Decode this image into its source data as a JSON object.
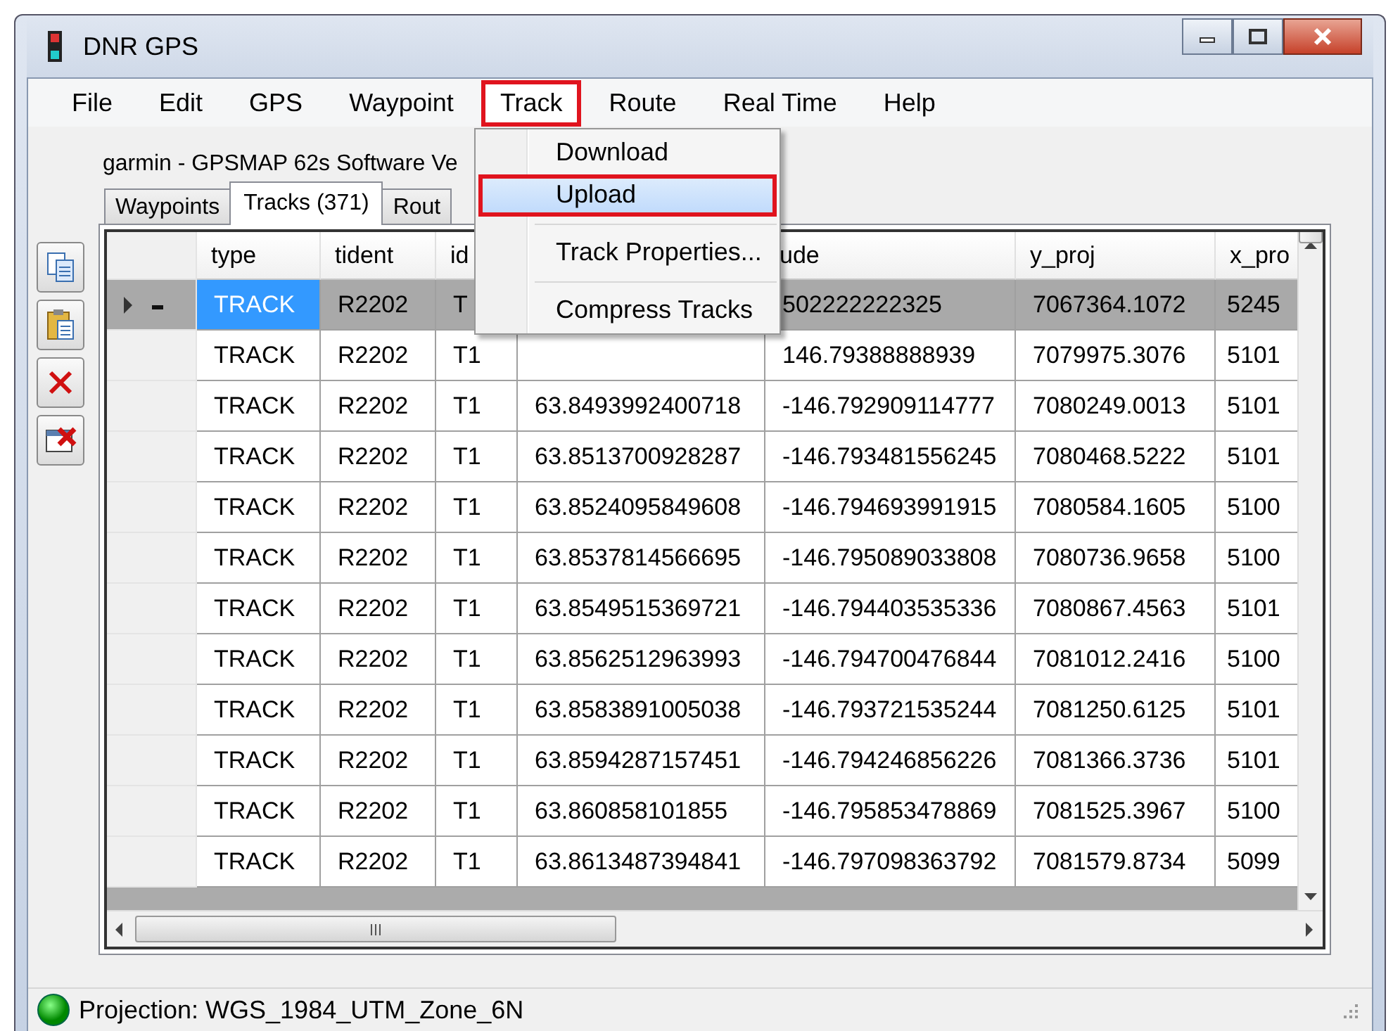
{
  "window": {
    "title": "DNR GPS"
  },
  "menu": [
    {
      "label": "File",
      "selected": false
    },
    {
      "label": "Edit",
      "selected": false
    },
    {
      "label": "GPS",
      "selected": false
    },
    {
      "label": "Waypoint",
      "selected": false
    },
    {
      "label": "Track",
      "selected": true
    },
    {
      "label": "Route",
      "selected": false
    },
    {
      "label": "Real Time",
      "selected": false
    },
    {
      "label": "Help",
      "selected": false
    }
  ],
  "dropdown": [
    {
      "kind": "item",
      "label": "Download",
      "selected": false
    },
    {
      "kind": "item",
      "label": "Upload",
      "selected": true
    },
    {
      "kind": "separator"
    },
    {
      "kind": "item",
      "label": "Track Properties...",
      "selected": false
    },
    {
      "kind": "separator"
    },
    {
      "kind": "item",
      "label": "Compress Tracks",
      "selected": false
    }
  ],
  "device": "garmin - GPSMAP 62s Software Ve",
  "tabs": [
    {
      "label": "Waypoints",
      "selected": false
    },
    {
      "label": "Tracks (371)",
      "selected": true
    },
    {
      "label": "Rout",
      "selected": false
    }
  ],
  "table": {
    "columns": [
      "type",
      "tident",
      "id",
      null,
      "ude",
      "y_proj",
      "x_pro"
    ],
    "rows": [
      {
        "selected": true,
        "current": true,
        "cells": [
          "TRACK",
          "R2202",
          "T",
          null,
          "502222222325",
          "7067364.1072",
          "5245"
        ]
      },
      {
        "selected": false,
        "current": false,
        "cells": [
          "TRACK",
          "R2202",
          "T1",
          null,
          "146.79388888939",
          "7079975.3076",
          "5101"
        ]
      },
      {
        "selected": false,
        "current": false,
        "cells": [
          "TRACK",
          "R2202",
          "T1",
          "63.8493992400718",
          "-146.792909114777",
          "7080249.0013",
          "5101"
        ]
      },
      {
        "selected": false,
        "current": false,
        "cells": [
          "TRACK",
          "R2202",
          "T1",
          "63.8513700928287",
          "-146.793481556245",
          "7080468.5222",
          "5101"
        ]
      },
      {
        "selected": false,
        "current": false,
        "cells": [
          "TRACK",
          "R2202",
          "T1",
          "63.8524095849608",
          "-146.794693991915",
          "7080584.1605",
          "5100"
        ]
      },
      {
        "selected": false,
        "current": false,
        "cells": [
          "TRACK",
          "R2202",
          "T1",
          "63.8537814566695",
          "-146.795089033808",
          "7080736.9658",
          "5100"
        ]
      },
      {
        "selected": false,
        "current": false,
        "cells": [
          "TRACK",
          "R2202",
          "T1",
          "63.8549515369721",
          "-146.794403535336",
          "7080867.4563",
          "5101"
        ]
      },
      {
        "selected": false,
        "current": false,
        "cells": [
          "TRACK",
          "R2202",
          "T1",
          "63.8562512963993",
          "-146.794700476844",
          "7081012.2416",
          "5100"
        ]
      },
      {
        "selected": false,
        "current": false,
        "cells": [
          "TRACK",
          "R2202",
          "T1",
          "63.8583891005038",
          "-146.793721535244",
          "7081250.6125",
          "5101"
        ]
      },
      {
        "selected": false,
        "current": false,
        "cells": [
          "TRACK",
          "R2202",
          "T1",
          "63.8594287157451",
          "-146.794246856226",
          "7081366.3736",
          "5101"
        ]
      },
      {
        "selected": false,
        "current": false,
        "cells": [
          "TRACK",
          "R2202",
          "T1",
          "63.860858101855",
          "-146.795853478869",
          "7081525.3967",
          "5100"
        ]
      },
      {
        "selected": false,
        "current": false,
        "cells": [
          "TRACK",
          "R2202",
          "T1",
          "63.8613487394841",
          "-146.797098363792",
          "7081579.8734",
          "5099"
        ]
      }
    ]
  },
  "status_bar": {
    "text": "Projection: WGS_1984_UTM_Zone_6N"
  }
}
